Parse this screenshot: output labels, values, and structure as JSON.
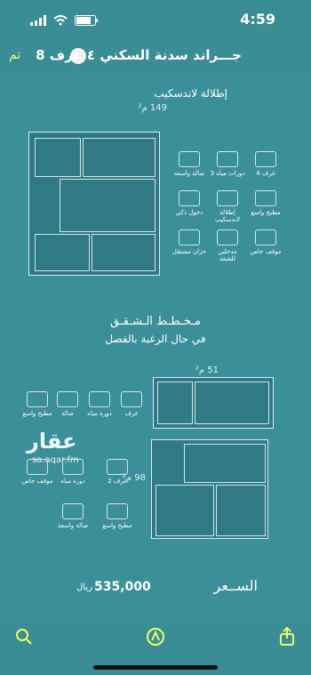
{
  "status_bar": {
    "time": "4:59"
  },
  "navbar": {
    "done_label": "تم",
    "title": "جـــراند سدنة  السكني ٤ غرف 8"
  },
  "document": {
    "top_heading": "إطلالة لاندسكيب",
    "top_area": "149 م²",
    "amenities_top": [
      "4 غرف",
      "3 دورات مياه",
      "صالة واسعة",
      "مطبخ واسع",
      "إطلالة لاندسكيب",
      "دخول ذكي",
      "موقف خاص",
      "مدخلين للشقة",
      "خزان مستقل"
    ],
    "split_title_line1": "مـخـطـط الـشـقـق",
    "split_title_line2": "في حال الرغبة بالفصل",
    "unit_a_area": "51 م²",
    "unit_b_area": "98 م²",
    "amenities_unit_a": [
      "غرف",
      "دورة مياه",
      "صالة",
      "مطبخ واسع"
    ],
    "amenities_unit_b": [
      "2 غرف",
      "دورة مياه",
      "موقف خاص",
      "مطبخ واسع",
      "صالة واسعة"
    ],
    "watermark": "عقار",
    "watermark_sub": "sa.aqar.fm",
    "price_label": "الســعر",
    "price": "535,000",
    "currency": "ريال"
  },
  "toolbar": {
    "search": "search-icon",
    "markup": "markup-icon",
    "share": "share-icon"
  },
  "colors": {
    "background": "#3a8c95",
    "done": "#e6ff6a",
    "text": "#ffffff"
  }
}
